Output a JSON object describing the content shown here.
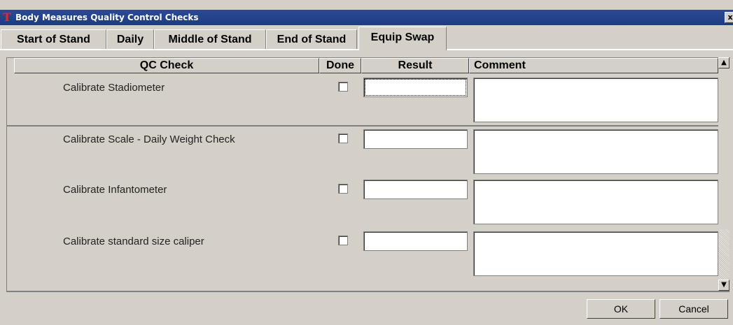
{
  "window": {
    "title": "Body Measures Quality Control Checks",
    "close_label": "x"
  },
  "tabs": [
    "Start of Stand",
    "Daily",
    "Middle of Stand",
    "End of Stand",
    "Equip Swap"
  ],
  "grid": {
    "headers": {
      "check": "QC Check",
      "done": "Done",
      "result": "Result",
      "comment": "Comment"
    },
    "rows": [
      {
        "label": "Calibrate Stadiometer",
        "done": false,
        "result": "",
        "comment": ""
      },
      {
        "label": "Calibrate Scale - Daily Weight Check",
        "done": false,
        "result": "",
        "comment": ""
      },
      {
        "label": "Calibrate Infantometer",
        "done": false,
        "result": "",
        "comment": ""
      },
      {
        "label": "Calibrate standard size caliper",
        "done": false,
        "result": "",
        "comment": ""
      }
    ]
  },
  "scroll": {
    "up": "▲",
    "down": "▼"
  },
  "buttons": {
    "ok": "OK",
    "cancel": "Cancel"
  }
}
